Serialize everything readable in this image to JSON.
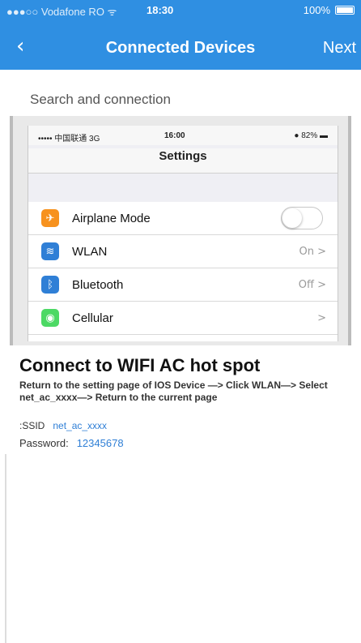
{
  "status_bar": {
    "carrier": "●●●○○ Vodafone RO ᯤ",
    "time": "18:30",
    "battery": "100%"
  },
  "nav": {
    "back_icon": "chevron-left-icon",
    "title": "Connected Devices",
    "next_label": "Next"
  },
  "section_title": "Search and connection",
  "phone": {
    "status_left": "••••• 中国联通 3G",
    "status_time": "16:00",
    "status_right": "82%",
    "title": "Settings",
    "rows": [
      {
        "label": "Airplane Mode",
        "icon": "airplane-icon",
        "value": "",
        "toggle": true,
        "color": "#f7921e"
      },
      {
        "label": "WLAN",
        "icon": "wifi-icon",
        "value": "On >",
        "toggle": false,
        "color": "#2f7fd6"
      },
      {
        "label": "Bluetooth",
        "icon": "bluetooth-icon",
        "value": "Off >",
        "toggle": false,
        "color": "#2f7fd6"
      },
      {
        "label": "Cellular",
        "icon": "cellular-icon",
        "value": ">",
        "toggle": false,
        "color": "#4cd964"
      }
    ]
  },
  "instructions": {
    "title": "Connect to WIFI AC hot spot",
    "body": "Return to the setting page of IOS Device —> Click WLAN—> Select net_ac_xxxx—> Return to the current page",
    "ssid_label": ":SSID",
    "ssid_value": "net_ac_xxxx",
    "password_label": "Password:",
    "password_value": "12345678"
  },
  "colors": {
    "header": "#2f8fe2",
    "link": "#2f7fd6"
  }
}
